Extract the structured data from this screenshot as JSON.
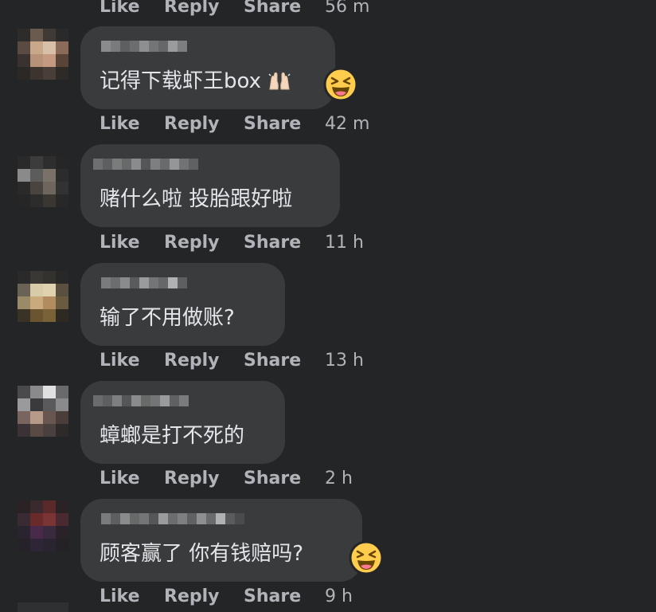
{
  "actions": {
    "like": "Like",
    "reply": "Reply",
    "share": "Share"
  },
  "top_partial": {
    "timestamp": "56 m"
  },
  "comments": [
    {
      "text": "记得下载虾王box",
      "inline_emoji": "raised-hands-emoji",
      "reaction_emoji": "laughing-squinting-emoji",
      "timestamp": "42 m"
    },
    {
      "text": "赌什么啦 投胎跟好啦",
      "timestamp": "11 h"
    },
    {
      "text": "输了不用做账?",
      "timestamp": "13 h"
    },
    {
      "text": "蟑螂是打不死的",
      "timestamp": "2 h"
    },
    {
      "text": "顾客赢了 你有钱赔吗?",
      "reaction_emoji": "laughing-squinting-emoji",
      "timestamp": "9 h"
    }
  ],
  "colors": {
    "background": "#242526",
    "bubble": "#3a3b3c",
    "text": "#e4e6eb",
    "meta": "#b0b3b8",
    "emoji_yellow": "#ffcc4d"
  }
}
